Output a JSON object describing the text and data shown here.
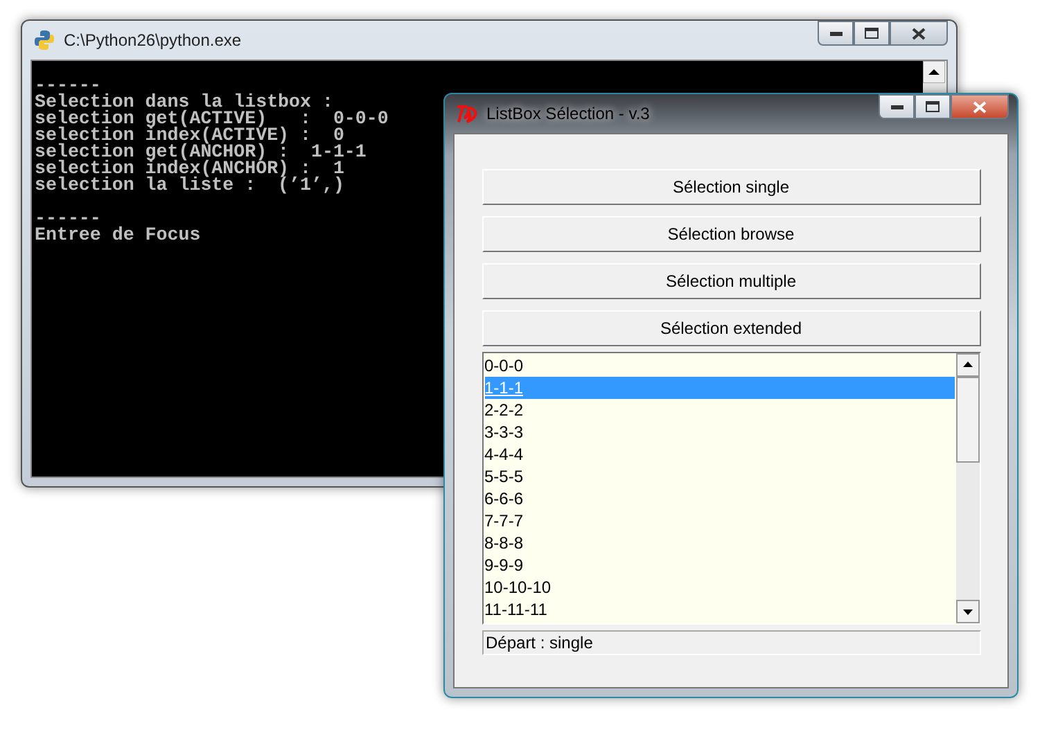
{
  "console_window": {
    "title": "C:\\Python26\\python.exe",
    "blocks": [
      [
        "------",
        "Selection dans la listbox :",
        "selection get(ACTIVE)   :  0-0-0",
        "selection index(ACTIVE) :  0",
        "selection get(ANCHOR) :  1-1-1",
        "selection index(ANCHOR) :  1",
        "selection la liste :  (’1’,)"
      ],
      [
        "------",
        "Entree de Focus"
      ]
    ]
  },
  "listbox_window": {
    "title": "ListBox Sélection - v.3",
    "buttons": [
      "Sélection single",
      "Sélection browse",
      "Sélection multiple",
      "Sélection extended"
    ],
    "items": [
      {
        "label": "0-0-0",
        "selected": false
      },
      {
        "label": "1-1-1",
        "selected": true
      },
      {
        "label": "2-2-2",
        "selected": false
      },
      {
        "label": "3-3-3",
        "selected": false
      },
      {
        "label": "4-4-4",
        "selected": false
      },
      {
        "label": "5-5-5",
        "selected": false
      },
      {
        "label": "6-6-6",
        "selected": false
      },
      {
        "label": "7-7-7",
        "selected": false
      },
      {
        "label": "8-8-8",
        "selected": false
      },
      {
        "label": "9-9-9",
        "selected": false
      },
      {
        "label": "10-10-10",
        "selected": false
      },
      {
        "label": "11-11-11",
        "selected": false
      }
    ],
    "status": "Départ : single"
  }
}
